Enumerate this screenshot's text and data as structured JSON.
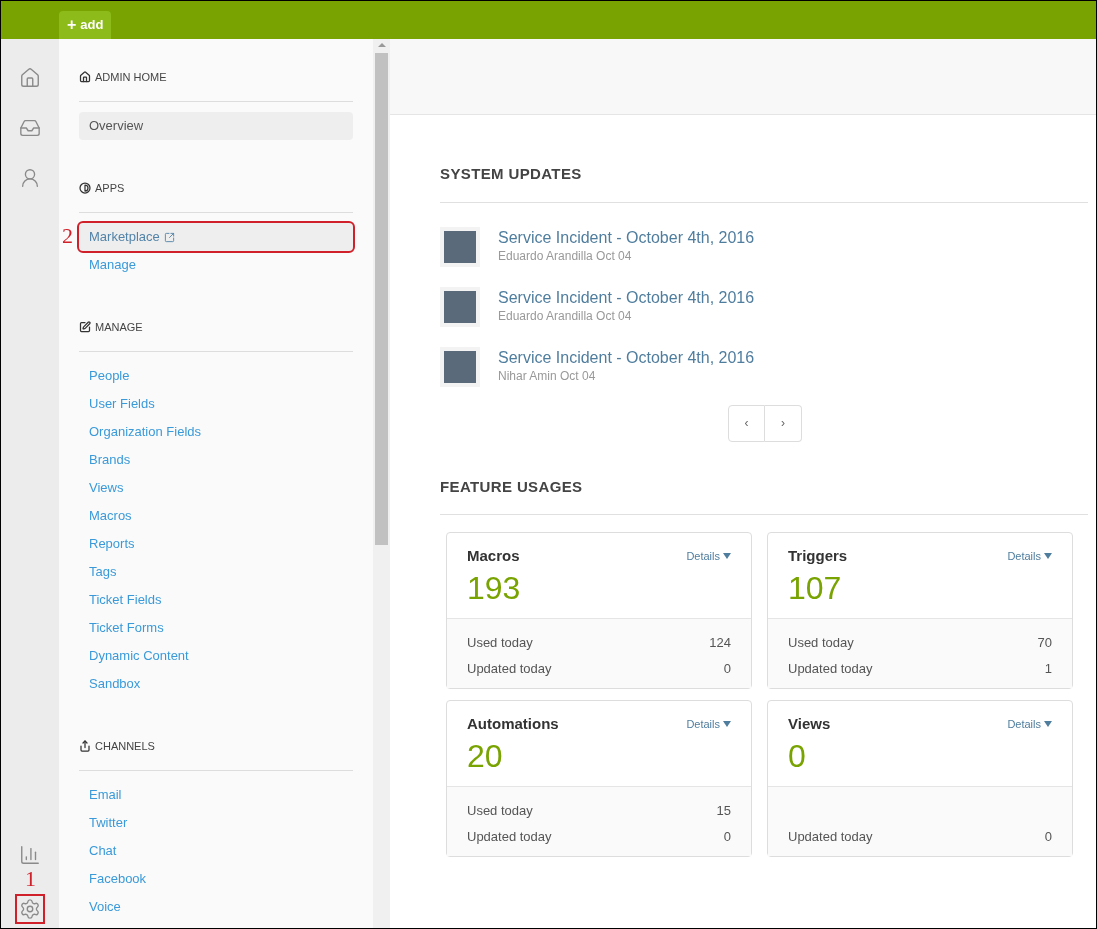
{
  "top_bar": {
    "add_button": {
      "icon": "+",
      "label": "add"
    }
  },
  "rail": [
    {
      "kind": "home"
    },
    {
      "kind": "tickets"
    },
    {
      "kind": "users"
    },
    {
      "kind": "reports"
    },
    {
      "kind": "settings",
      "callout": "1"
    }
  ],
  "sidebar": {
    "sections": [
      {
        "kind": "home",
        "title": "ADMIN HOME",
        "items": [
          {
            "label": "Overview",
            "selected": true,
            "hovered": true,
            "external": false
          }
        ]
      },
      {
        "kind": "apps",
        "title": "APPS",
        "items": [
          {
            "label": "Marketplace",
            "selected": false,
            "hovered": true,
            "external": true,
            "callout": "2"
          },
          {
            "label": "Manage",
            "selected": false,
            "hovered": false,
            "external": false
          }
        ]
      },
      {
        "kind": "manage",
        "title": "MANAGE",
        "items": [
          {
            "label": "People",
            "selected": false,
            "hovered": false,
            "external": false
          },
          {
            "label": "User Fields",
            "selected": false,
            "hovered": false,
            "external": false
          },
          {
            "label": "Organization Fields",
            "selected": false,
            "hovered": false,
            "external": false
          },
          {
            "label": "Brands",
            "selected": false,
            "hovered": false,
            "external": false
          },
          {
            "label": "Views",
            "selected": false,
            "hovered": false,
            "external": false
          },
          {
            "label": "Macros",
            "selected": false,
            "hovered": false,
            "external": false
          },
          {
            "label": "Reports",
            "selected": false,
            "hovered": false,
            "external": false
          },
          {
            "label": "Tags",
            "selected": false,
            "hovered": false,
            "external": false
          },
          {
            "label": "Ticket Fields",
            "selected": false,
            "hovered": false,
            "external": false
          },
          {
            "label": "Ticket Forms",
            "selected": false,
            "hovered": false,
            "external": false
          },
          {
            "label": "Dynamic Content",
            "selected": false,
            "hovered": false,
            "external": false
          },
          {
            "label": "Sandbox",
            "selected": false,
            "hovered": false,
            "external": false
          }
        ]
      },
      {
        "kind": "channels",
        "title": "CHANNELS",
        "items": [
          {
            "label": "Email",
            "selected": false,
            "hovered": false,
            "external": false
          },
          {
            "label": "Twitter",
            "selected": false,
            "hovered": false,
            "external": false
          },
          {
            "label": "Chat",
            "selected": false,
            "hovered": false,
            "external": false
          },
          {
            "label": "Facebook",
            "selected": false,
            "hovered": false,
            "external": false
          },
          {
            "label": "Voice",
            "selected": false,
            "hovered": false,
            "external": false
          }
        ]
      }
    ]
  },
  "system_updates": {
    "title": "SYSTEM UPDATES",
    "items": [
      {
        "title": "Service Incident - October 4th, 2016",
        "meta": "Eduardo Arandilla Oct 04"
      },
      {
        "title": "Service Incident - October 4th, 2016",
        "meta": "Eduardo Arandilla Oct 04"
      },
      {
        "title": "Service Incident - October 4th, 2016",
        "meta": "Nihar Amin Oct 04"
      }
    ],
    "pager": {
      "prev": "‹",
      "next": "›"
    }
  },
  "feature_usages": {
    "title": "FEATURE USAGES",
    "cards": [
      {
        "name": "Macros",
        "details": "Details",
        "count": "193",
        "rows": [
          {
            "label": "Used today",
            "value": "124"
          },
          {
            "label": "Updated today",
            "value": "0"
          }
        ]
      },
      {
        "name": "Triggers",
        "details": "Details",
        "count": "107",
        "rows": [
          {
            "label": "Used today",
            "value": "70"
          },
          {
            "label": "Updated today",
            "value": "1"
          }
        ]
      },
      {
        "name": "Automations",
        "details": "Details",
        "count": "20",
        "rows": [
          {
            "label": "Used today",
            "value": "15"
          },
          {
            "label": "Updated today",
            "value": "0"
          }
        ]
      },
      {
        "name": "Views",
        "details": "Details",
        "count": "0",
        "rows": [
          {
            "label": "Updated today",
            "value": "0"
          }
        ]
      }
    ]
  }
}
